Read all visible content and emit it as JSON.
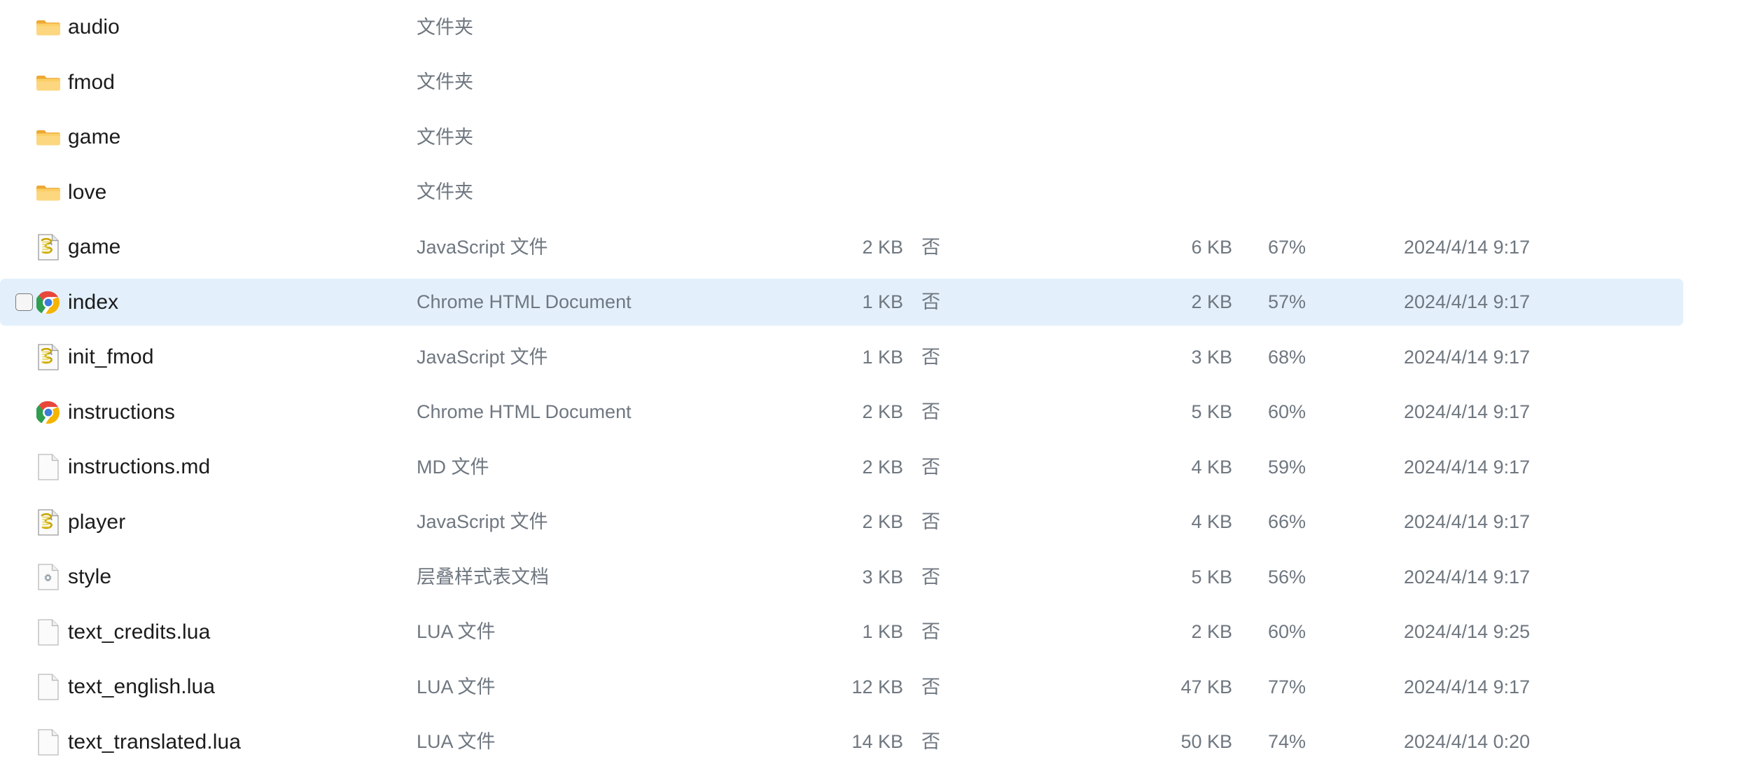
{
  "view": {
    "kind": "file-explorer-list",
    "selection_color": "#e3f0fc",
    "text_color": "#1b1b1b",
    "meta_color": "#6f7780"
  },
  "rows": [
    {
      "name": "audio",
      "icon": "folder-icon",
      "type": "文件夹",
      "size": "",
      "locked": "",
      "original_size": "",
      "ratio": "",
      "date": "",
      "selected": false,
      "checkbox": false
    },
    {
      "name": "fmod",
      "icon": "folder-icon",
      "type": "文件夹",
      "size": "",
      "locked": "",
      "original_size": "",
      "ratio": "",
      "date": "",
      "selected": false,
      "checkbox": false
    },
    {
      "name": "game",
      "icon": "folder-icon",
      "type": "文件夹",
      "size": "",
      "locked": "",
      "original_size": "",
      "ratio": "",
      "date": "",
      "selected": false,
      "checkbox": false
    },
    {
      "name": "love",
      "icon": "folder-icon",
      "type": "文件夹",
      "size": "",
      "locked": "",
      "original_size": "",
      "ratio": "",
      "date": "",
      "selected": false,
      "checkbox": false
    },
    {
      "name": "game",
      "icon": "javascript-file-icon",
      "type": "JavaScript 文件",
      "size": "2 KB",
      "locked": "否",
      "original_size": "6 KB",
      "ratio": "67%",
      "date": "2024/4/14 9:17",
      "selected": false,
      "checkbox": false
    },
    {
      "name": "index",
      "icon": "chrome-icon",
      "type": "Chrome HTML Document",
      "size": "1 KB",
      "locked": "否",
      "original_size": "2 KB",
      "ratio": "57%",
      "date": "2024/4/14 9:17",
      "selected": true,
      "checkbox": true
    },
    {
      "name": "init_fmod",
      "icon": "javascript-file-icon",
      "type": "JavaScript 文件",
      "size": "1 KB",
      "locked": "否",
      "original_size": "3 KB",
      "ratio": "68%",
      "date": "2024/4/14 9:17",
      "selected": false,
      "checkbox": false
    },
    {
      "name": "instructions",
      "icon": "chrome-icon",
      "type": "Chrome HTML Document",
      "size": "2 KB",
      "locked": "否",
      "original_size": "5 KB",
      "ratio": "60%",
      "date": "2024/4/14 9:17",
      "selected": false,
      "checkbox": false
    },
    {
      "name": "instructions.md",
      "icon": "blank-document-icon",
      "type": "MD 文件",
      "size": "2 KB",
      "locked": "否",
      "original_size": "4 KB",
      "ratio": "59%",
      "date": "2024/4/14 9:17",
      "selected": false,
      "checkbox": false
    },
    {
      "name": "player",
      "icon": "javascript-file-icon",
      "type": "JavaScript 文件",
      "size": "2 KB",
      "locked": "否",
      "original_size": "4 KB",
      "ratio": "66%",
      "date": "2024/4/14 9:17",
      "selected": false,
      "checkbox": false
    },
    {
      "name": "style",
      "icon": "css-file-icon",
      "type": "层叠样式表文档",
      "size": "3 KB",
      "locked": "否",
      "original_size": "5 KB",
      "ratio": "56%",
      "date": "2024/4/14 9:17",
      "selected": false,
      "checkbox": false
    },
    {
      "name": "text_credits.lua",
      "icon": "blank-document-icon",
      "type": "LUA 文件",
      "size": "1 KB",
      "locked": "否",
      "original_size": "2 KB",
      "ratio": "60%",
      "date": "2024/4/14 9:25",
      "selected": false,
      "checkbox": false
    },
    {
      "name": "text_english.lua",
      "icon": "blank-document-icon",
      "type": "LUA 文件",
      "size": "12 KB",
      "locked": "否",
      "original_size": "47 KB",
      "ratio": "77%",
      "date": "2024/4/14 9:17",
      "selected": false,
      "checkbox": false
    },
    {
      "name": "text_translated.lua",
      "icon": "blank-document-icon",
      "type": "LUA 文件",
      "size": "14 KB",
      "locked": "否",
      "original_size": "50 KB",
      "ratio": "74%",
      "date": "2024/4/14 0:20",
      "selected": false,
      "checkbox": false
    }
  ]
}
